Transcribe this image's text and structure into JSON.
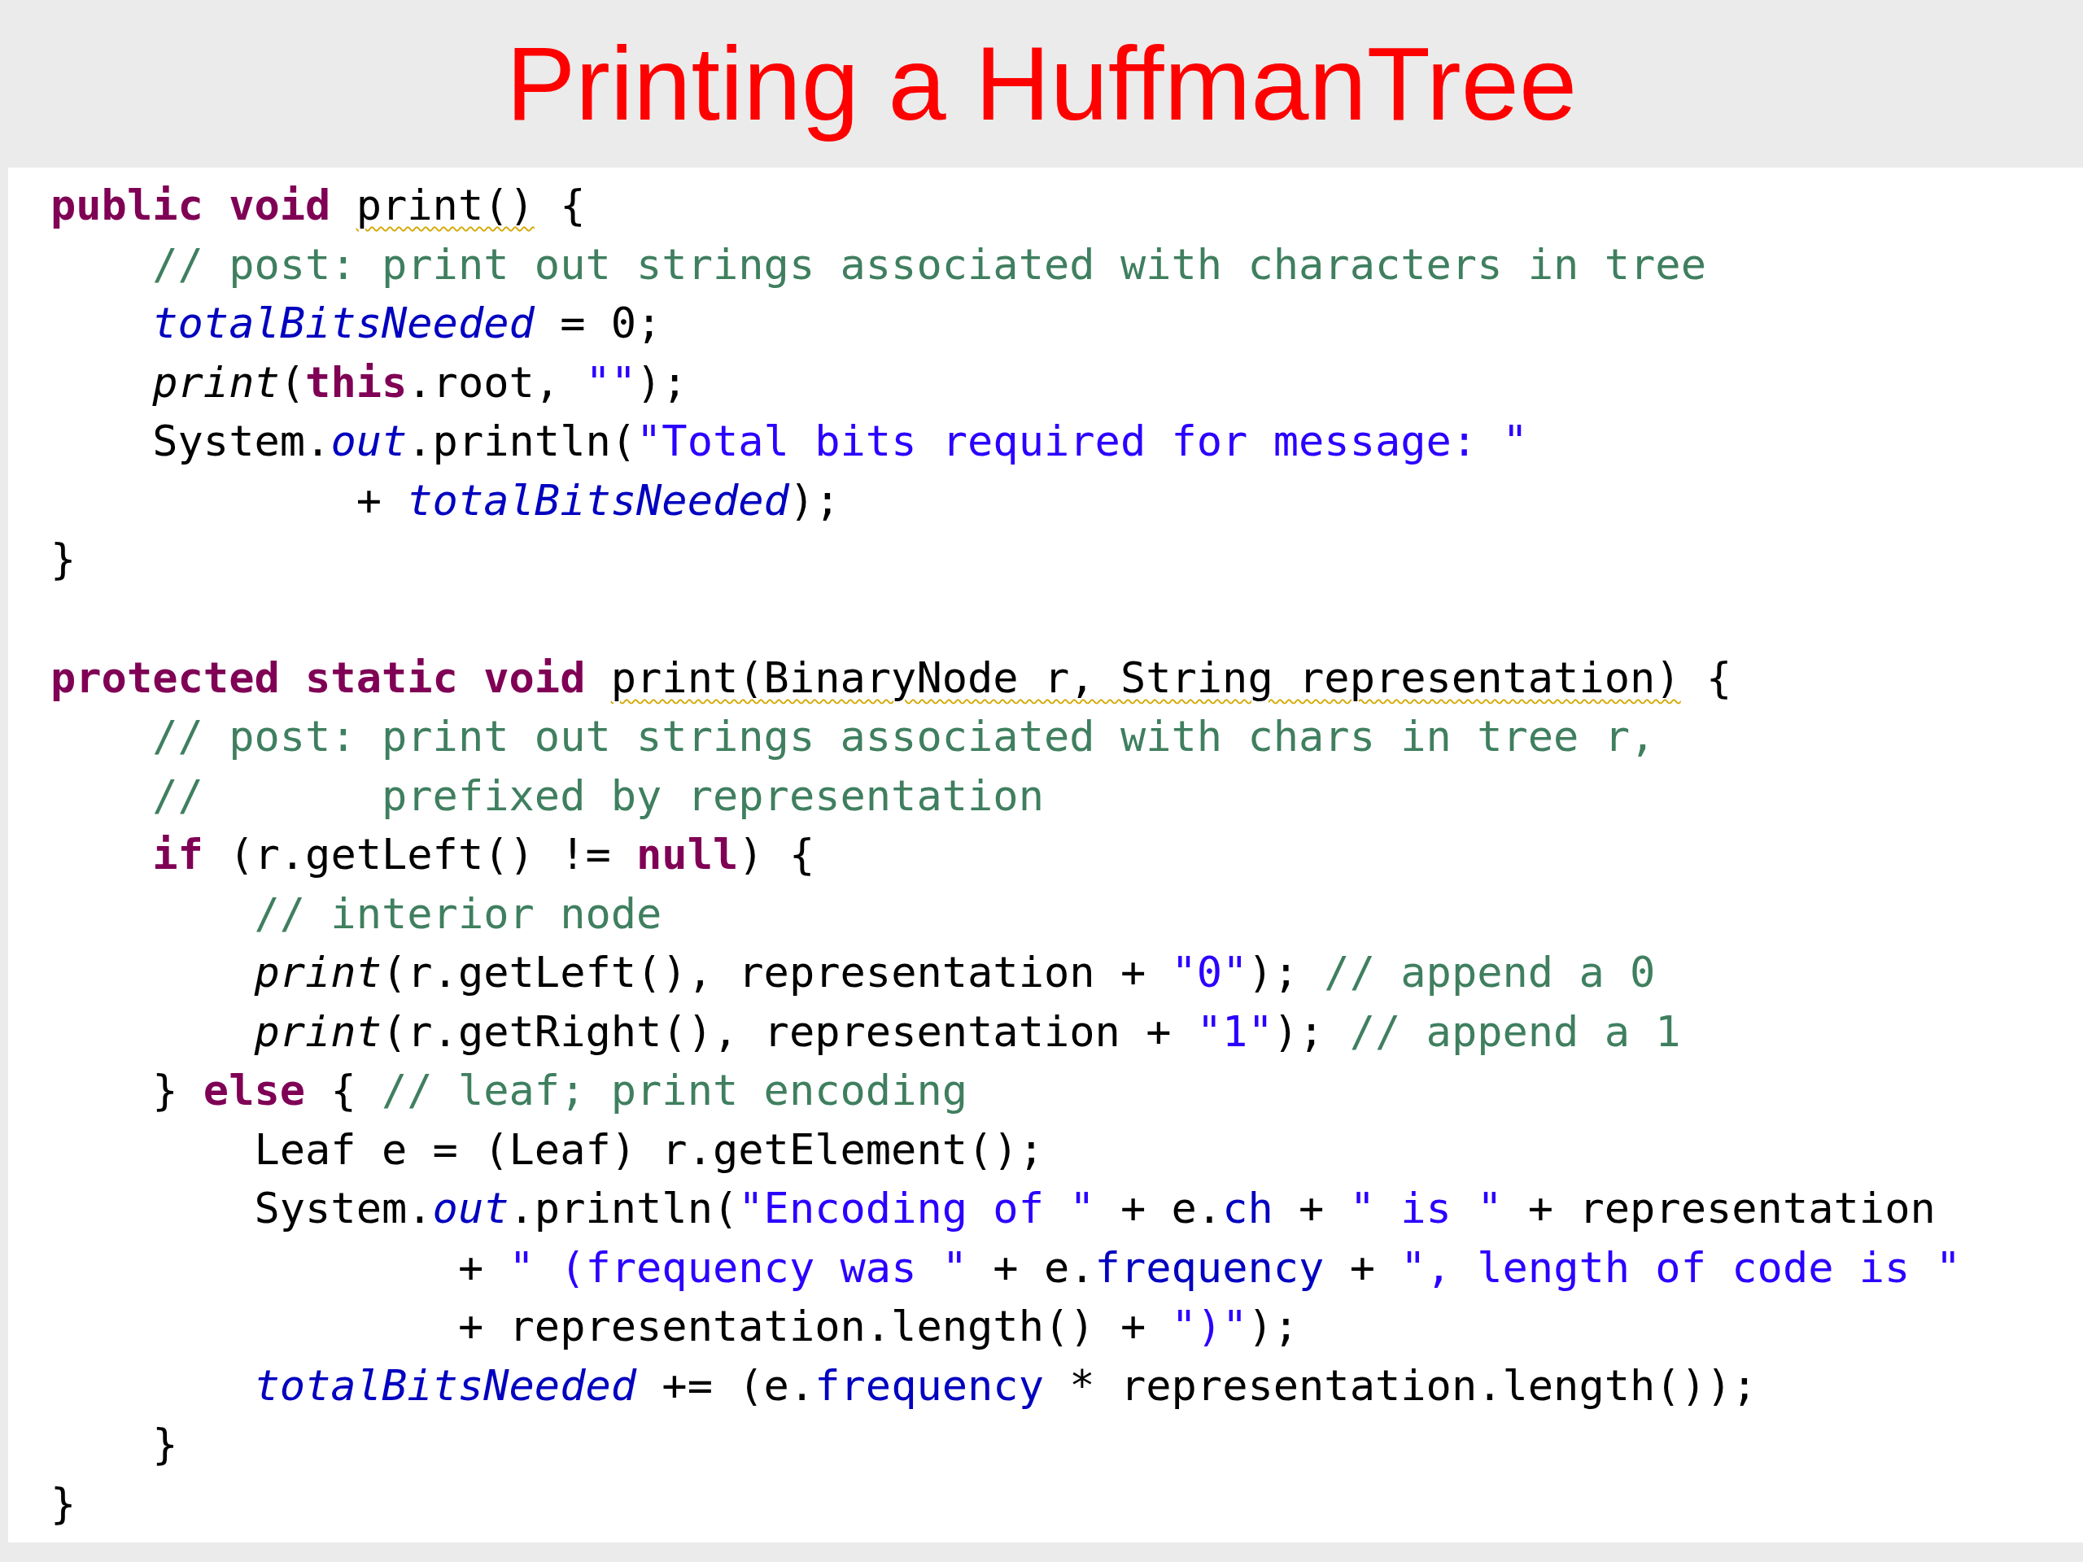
{
  "title": "Printing a HuffmanTree",
  "methods": [
    {
      "lines": [
        [
          {
            "kind": "kw",
            "text": "public void "
          },
          {
            "kind": "plain",
            "text": "print()",
            "warn": true
          },
          {
            "kind": "plain",
            "text": " {"
          }
        ],
        [
          {
            "kind": "comment",
            "text": "    // post: print out strings associated with characters in tree"
          }
        ],
        [
          {
            "kind": "sfield",
            "text": "    totalBitsNeeded"
          },
          {
            "kind": "plain",
            "text": " = 0;"
          }
        ],
        [
          {
            "kind": "smethod",
            "text": "    print"
          },
          {
            "kind": "plain",
            "text": "("
          },
          {
            "kind": "kw",
            "text": "this"
          },
          {
            "kind": "plain",
            "text": ".root, "
          },
          {
            "kind": "string",
            "text": "\"\""
          },
          {
            "kind": "plain",
            "text": ");"
          }
        ],
        [
          {
            "kind": "plain",
            "text": "    System."
          },
          {
            "kind": "sfield",
            "text": "out"
          },
          {
            "kind": "plain",
            "text": ".println("
          },
          {
            "kind": "string",
            "text": "\"Total bits required for message: \""
          }
        ],
        [
          {
            "kind": "plain",
            "text": "            + "
          },
          {
            "kind": "sfield",
            "text": "totalBitsNeeded"
          },
          {
            "kind": "plain",
            "text": ");"
          }
        ],
        [
          {
            "kind": "plain",
            "text": "}"
          }
        ]
      ]
    },
    {
      "lines": [
        [
          {
            "kind": "kw",
            "text": "protected static void "
          },
          {
            "kind": "plain",
            "text": "print(BinaryNode r, String representation)",
            "warn": true
          },
          {
            "kind": "plain",
            "text": " {"
          }
        ],
        [
          {
            "kind": "comment",
            "text": "    // post: print out strings associated with chars in tree r,"
          }
        ],
        [
          {
            "kind": "comment",
            "text": "    //       prefixed by representation"
          }
        ],
        [
          {
            "kind": "kw",
            "text": "    if"
          },
          {
            "kind": "plain",
            "text": " (r.getLeft() != "
          },
          {
            "kind": "kw",
            "text": "null"
          },
          {
            "kind": "plain",
            "text": ") {"
          }
        ],
        [
          {
            "kind": "comment",
            "text": "        // interior node"
          }
        ],
        [
          {
            "kind": "smethod",
            "text": "        print"
          },
          {
            "kind": "plain",
            "text": "(r.getLeft(), representation + "
          },
          {
            "kind": "string",
            "text": "\"0\""
          },
          {
            "kind": "plain",
            "text": "); "
          },
          {
            "kind": "comment",
            "text": "// append a 0"
          }
        ],
        [
          {
            "kind": "smethod",
            "text": "        print"
          },
          {
            "kind": "plain",
            "text": "(r.getRight(), representation + "
          },
          {
            "kind": "string",
            "text": "\"1\""
          },
          {
            "kind": "plain",
            "text": "); "
          },
          {
            "kind": "comment",
            "text": "// append a 1"
          }
        ],
        [
          {
            "kind": "plain",
            "text": "    } "
          },
          {
            "kind": "kw",
            "text": "else"
          },
          {
            "kind": "plain",
            "text": " { "
          },
          {
            "kind": "comment",
            "text": "// leaf; print encoding"
          }
        ],
        [
          {
            "kind": "plain",
            "text": "        Leaf e = (Leaf) r.getElement();"
          }
        ],
        [
          {
            "kind": "plain",
            "text": "        System."
          },
          {
            "kind": "sfield",
            "text": "out"
          },
          {
            "kind": "plain",
            "text": ".println("
          },
          {
            "kind": "string",
            "text": "\"Encoding of \""
          },
          {
            "kind": "plain",
            "text": " + e."
          },
          {
            "kind": "field",
            "text": "ch"
          },
          {
            "kind": "plain",
            "text": " + "
          },
          {
            "kind": "string",
            "text": "\" is \""
          },
          {
            "kind": "plain",
            "text": " + representation"
          }
        ],
        [
          {
            "kind": "plain",
            "text": "                + "
          },
          {
            "kind": "string",
            "text": "\" (frequency was \""
          },
          {
            "kind": "plain",
            "text": " + e."
          },
          {
            "kind": "field",
            "text": "frequency"
          },
          {
            "kind": "plain",
            "text": " + "
          },
          {
            "kind": "string",
            "text": "\", length of code is \""
          }
        ],
        [
          {
            "kind": "plain",
            "text": "                + representation.length() + "
          },
          {
            "kind": "string",
            "text": "\")\""
          },
          {
            "kind": "plain",
            "text": ");"
          }
        ],
        [
          {
            "kind": "sfield",
            "text": "        totalBitsNeeded"
          },
          {
            "kind": "plain",
            "text": " += (e."
          },
          {
            "kind": "field",
            "text": "frequency"
          },
          {
            "kind": "plain",
            "text": " * representation.length());"
          }
        ],
        [
          {
            "kind": "plain",
            "text": "    }"
          }
        ],
        [
          {
            "kind": "plain",
            "text": "}"
          }
        ]
      ]
    }
  ]
}
